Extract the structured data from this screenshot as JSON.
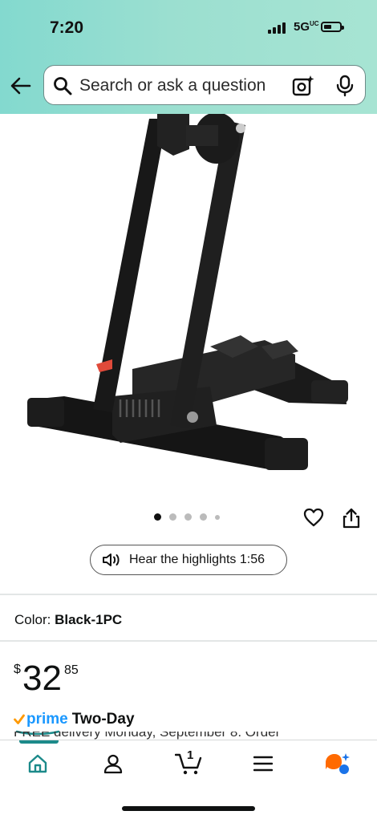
{
  "status_bar": {
    "time": "7:20",
    "network": "5G",
    "network_superscript": "UC"
  },
  "search": {
    "placeholder": "Search or ask a question"
  },
  "carousel": {
    "dot_count": 5,
    "active_index": 0
  },
  "highlights": {
    "label": "Hear the highlights 1:56"
  },
  "product": {
    "color_label": "Color:",
    "color_value": "Black-1PC",
    "price_symbol": "$",
    "price_whole": "32",
    "price_fraction": "85",
    "prime_label": "prime",
    "shipping_label": "Two-Day",
    "delivery_text_clipped": "FREE delivery Monday, September 8. Order"
  },
  "bottom_nav": {
    "items": [
      "home",
      "account",
      "cart",
      "menu",
      "rufus"
    ],
    "cart_count": "1",
    "active": "home"
  },
  "colors": {
    "header_start": "#83d9cf",
    "header_end": "#a7e4d3",
    "prime_blue": "#1a98ff",
    "nav_active": "#1c8a8a",
    "rufus_orange": "#ff6a00",
    "rufus_blue": "#1a73e8"
  }
}
